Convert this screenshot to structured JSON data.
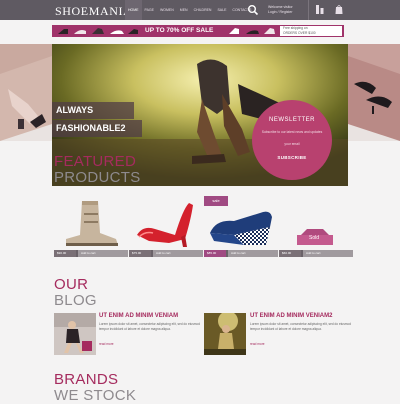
{
  "header": {
    "logo": "SHOEMANIAC",
    "nav": [
      "Home",
      "Page",
      "Women",
      "Men",
      "Children",
      "Sale",
      "Contacts"
    ],
    "account_line1": "Welcome visitor",
    "account_line2": "Login / Register"
  },
  "promo": {
    "text": "UP TO 70% OFF SALE",
    "box_line1": "Free shipping on",
    "box_line2": "ORDERS OVER $100"
  },
  "hero": {
    "caption_line1": "ALWAYS",
    "caption_line2": "FASHIONABLE2"
  },
  "newsletter": {
    "title": "NEWSLETTER",
    "text": "Subscribe to our latest news and updates",
    "input_placeholder": "your email",
    "button": "SUBSCRIBE"
  },
  "featured": {
    "title_line1": "FEATURED",
    "title_line2": "PRODUCTS",
    "sale_badge": "sale",
    "sold_badge": "Sold",
    "products": [
      {
        "price": "$90.00",
        "action": "Add to cart",
        "shoe": "boot-icon"
      },
      {
        "price": "$75.00",
        "action": "Add to cart",
        "shoe": "red-heel-icon"
      },
      {
        "price": "$85.00",
        "action": "Add to cart",
        "shoe": "wedge-icon"
      },
      {
        "price": "$60.00",
        "action": "Add to cart",
        "shoe": "sold-out-icon"
      }
    ]
  },
  "blog": {
    "title_line1": "OUR",
    "title_line2": "BLOG",
    "posts": [
      {
        "title": "UT ENIM AD MINIM VENIAM",
        "text": "Lorem ipsum dolor sit amet, consectetur adipiscing elit, sed do eiusmod tempor incididunt ut labore et dolore magna aliqua.",
        "more": "read more"
      },
      {
        "title": "UT ENIM AD MINIM VENIAM2",
        "text": "Lorem ipsum dolor sit amet, consectetur adipiscing elit, sed do eiusmod tempor incididunt ut labore et dolore magna aliqua.",
        "more": "read more"
      }
    ]
  },
  "brands": {
    "title_line1": "BRANDS",
    "title_line2": "WE STOCK"
  },
  "colors": {
    "accent": "#a52b5e",
    "header_bg": "#5f5a62",
    "newsletter_bg": "#b8416f"
  }
}
